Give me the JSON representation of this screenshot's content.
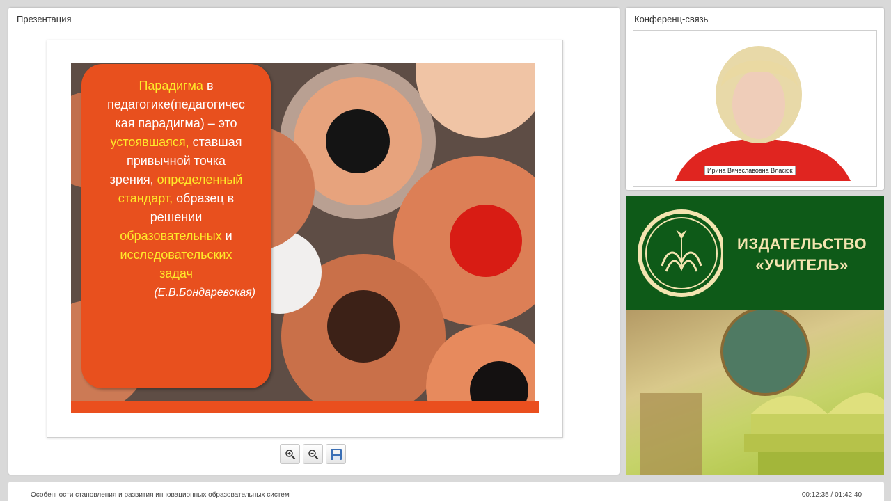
{
  "presentation": {
    "title": "Презентация",
    "slide": {
      "lines": [
        {
          "parts": [
            {
              "text": "Парадигма",
              "highlight": true
            },
            {
              "text": " в",
              "highlight": false
            }
          ]
        },
        {
          "parts": [
            {
              "text": "педагогике(педагогичес",
              "highlight": false
            }
          ]
        },
        {
          "parts": [
            {
              "text": "кая парадигма) – это",
              "highlight": false
            }
          ]
        },
        {
          "parts": [
            {
              "text": "устоявшаяся,",
              "highlight": true
            },
            {
              "text": " ставшая",
              "highlight": false
            }
          ]
        },
        {
          "parts": [
            {
              "text": "привычной точка",
              "highlight": false
            }
          ]
        },
        {
          "parts": [
            {
              "text": "зрения, ",
              "highlight": false
            },
            {
              "text": "определенный",
              "highlight": true
            }
          ]
        },
        {
          "parts": [
            {
              "text": "стандарт,",
              "highlight": true
            },
            {
              "text": " образец в",
              "highlight": false
            }
          ]
        },
        {
          "parts": [
            {
              "text": "решении",
              "highlight": false
            }
          ]
        },
        {
          "parts": [
            {
              "text": "образовательных",
              "highlight": true
            },
            {
              "text": " и",
              "highlight": false
            }
          ]
        },
        {
          "parts": [
            {
              "text": "исследовательских",
              "highlight": true
            }
          ]
        },
        {
          "parts": [
            {
              "text": "задач",
              "highlight": true
            }
          ]
        }
      ],
      "author": "(Е.В.Бондаревская)"
    },
    "toolbar": {
      "zoom_in_icon": "zoom-in-icon",
      "zoom_out_icon": "zoom-out-icon",
      "save_icon": "save-icon"
    }
  },
  "conference": {
    "title": "Конференц-связь",
    "participant_name": "Ирина Вячеславовна Власюк"
  },
  "banner": {
    "line1": "ИЗДАТЕЛЬСТВО",
    "line2": "«УЧИТЕЛЬ»"
  },
  "footer": {
    "lecture_title": "Особенности становления и развития инновационных образовательных систем",
    "time": "00:12:35 / 01:42:40"
  },
  "colors": {
    "slide_orange": "#e8501e",
    "highlight_yellow": "#ffea2a",
    "banner_green": "#0e5a18"
  }
}
